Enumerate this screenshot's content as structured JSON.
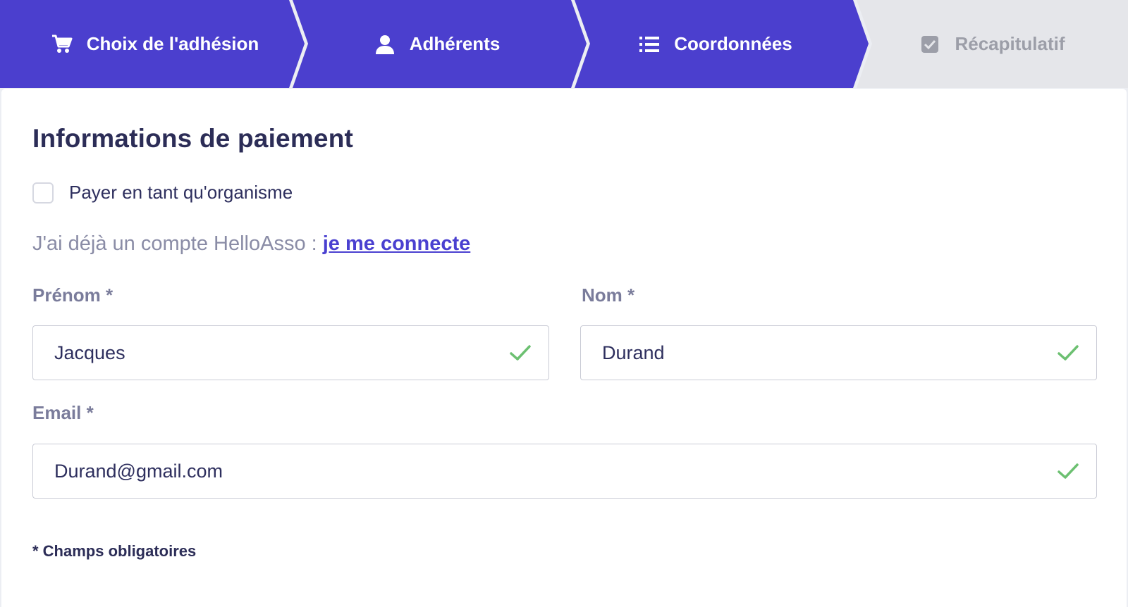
{
  "colors": {
    "accent": "#4b3fce",
    "inactive_step": "#e5e6ea",
    "valid": "#6cc071",
    "link": "#4a40d0"
  },
  "stepper": {
    "steps": [
      {
        "label": "Choix de l'adhésion",
        "icon": "cart-icon",
        "state": "done"
      },
      {
        "label": "Adhérents",
        "icon": "user-icon",
        "state": "done"
      },
      {
        "label": "Coordonnées",
        "icon": "list-icon",
        "state": "current"
      },
      {
        "label": "Récapitulatif",
        "icon": "checkbox-icon",
        "state": "todo"
      }
    ]
  },
  "form": {
    "title": "Informations de paiement",
    "organism_checkbox": {
      "label": "Payer en tant qu'organisme",
      "checked": false
    },
    "login_prompt": "J'ai déjà un compte HelloAsso : ",
    "login_link": "je me connecte",
    "firstname": {
      "label": "Prénom *",
      "value": "Jacques",
      "valid": true
    },
    "lastname": {
      "label": "Nom *",
      "value": "Durand",
      "valid": true
    },
    "email": {
      "label": "Email *",
      "value": "Durand@gmail.com",
      "valid": true
    },
    "required_note": "* Champs obligatoires"
  }
}
